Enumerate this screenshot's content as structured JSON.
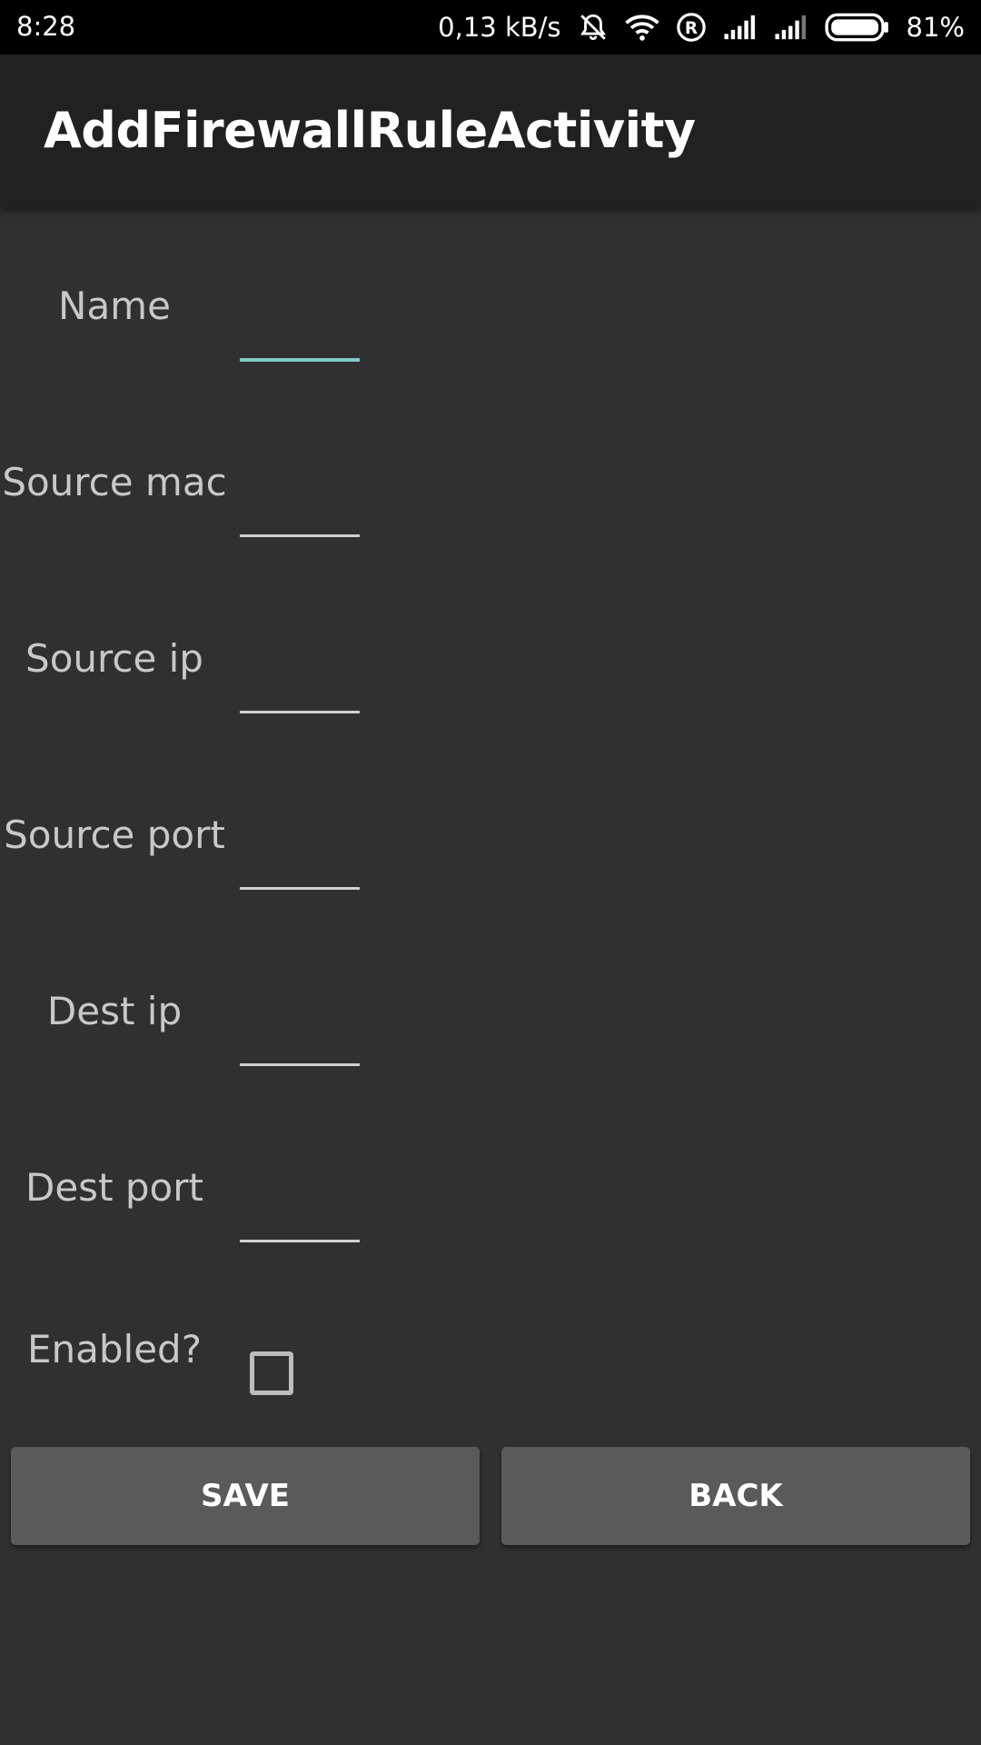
{
  "status_bar": {
    "time": "8:28",
    "network_speed": "0,13 kB/s",
    "battery_percent": "81%",
    "battery_level": 0.81,
    "icons": [
      "mute-icon",
      "wifi-icon",
      "roaming-icon",
      "signal-icon",
      "signal-icon-2",
      "battery-icon"
    ]
  },
  "app_bar": {
    "title": "AddFirewallRuleActivity"
  },
  "form": {
    "fields": [
      {
        "label": "Name",
        "value": "",
        "focused": true
      },
      {
        "label": "Source mac",
        "value": ""
      },
      {
        "label": "Source ip",
        "value": ""
      },
      {
        "label": "Source port",
        "value": ""
      },
      {
        "label": "Dest ip",
        "value": ""
      },
      {
        "label": "Dest port",
        "value": ""
      }
    ],
    "enabled_label": "Enabled?",
    "enabled_checked": false
  },
  "buttons": {
    "save": "SAVE",
    "back": "BACK"
  },
  "colors": {
    "background": "#303030",
    "app_bar": "#212121",
    "accent": "#80cbc4",
    "button": "#5a5a5b"
  }
}
